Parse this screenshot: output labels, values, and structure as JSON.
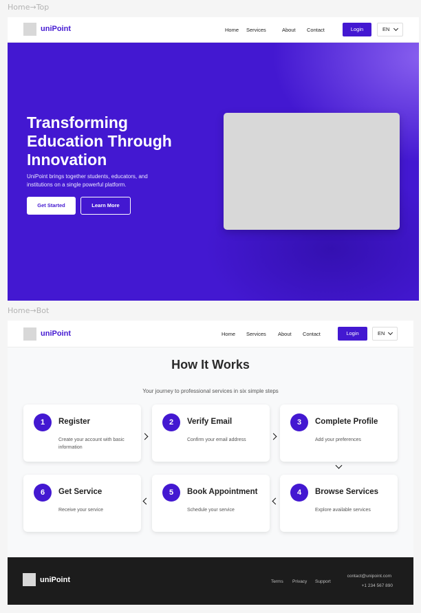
{
  "frames": {
    "top_label": "Home→Top",
    "bot_label": "Home→Bot"
  },
  "nav": {
    "brand": "uniPoint",
    "links": [
      "Home",
      "Services",
      "About",
      "Contact"
    ],
    "login": "Login",
    "lang": "EN"
  },
  "hero": {
    "title": "Transforming Education Through Innovation",
    "subtitle": "UniPoint brings together students, educators, and institutions on a single powerful platform.",
    "primary_cta": "Get Started",
    "secondary_cta": "Learn More"
  },
  "how": {
    "title": "How It Works",
    "subtitle": "Your journey to professional services in six simple steps",
    "steps": [
      {
        "num": "1",
        "title": "Register",
        "desc": "Create your account with basic information"
      },
      {
        "num": "2",
        "title": "Verify Email",
        "desc": "Confirm your email address"
      },
      {
        "num": "3",
        "title": "Complete Profile",
        "desc": "Add your preferences"
      },
      {
        "num": "4",
        "title": "Browse Services",
        "desc": "Explore available services"
      },
      {
        "num": "5",
        "title": "Book Appointment",
        "desc": "Schedule your service"
      },
      {
        "num": "6",
        "title": "Get Service",
        "desc": "Receive your service"
      }
    ]
  },
  "footer": {
    "brand": "uniPoint",
    "links": [
      "Terms",
      "Privacy",
      "Support"
    ],
    "email": "contact@unipoint.com",
    "phone": "+1 234 567 890"
  },
  "colors": {
    "accent": "#4318d1",
    "footer_bg": "#1c1c1c",
    "placeholder": "#d8d8d8"
  }
}
